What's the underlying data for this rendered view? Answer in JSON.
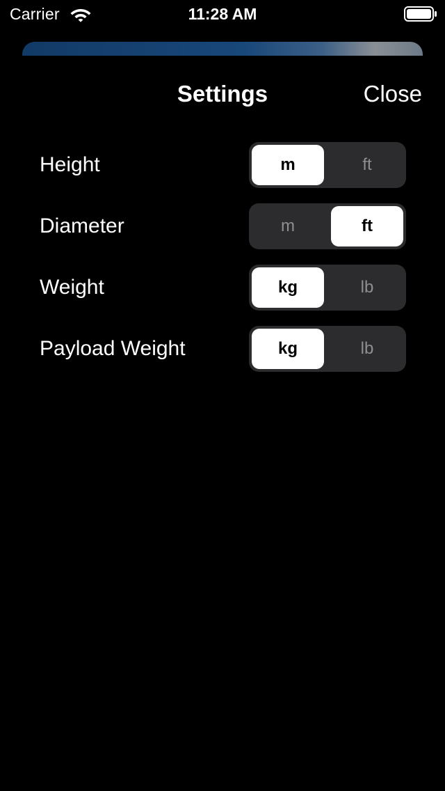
{
  "status_bar": {
    "carrier": "Carrier",
    "time": "11:28 AM",
    "icons": [
      "wifi-icon",
      "battery-icon"
    ]
  },
  "header": {
    "title": "Settings",
    "close_label": "Close"
  },
  "settings": [
    {
      "label": "Height",
      "options": [
        "m",
        "ft"
      ],
      "selected": 0
    },
    {
      "label": "Diameter",
      "options": [
        "m",
        "ft"
      ],
      "selected": 1
    },
    {
      "label": "Weight",
      "options": [
        "kg",
        "lb"
      ],
      "selected": 0
    },
    {
      "label": "Payload Weight",
      "options": [
        "kg",
        "lb"
      ],
      "selected": 0
    }
  ],
  "colors": {
    "background": "#000000",
    "segment_track": "#2c2c2e",
    "segment_selected": "#ffffff",
    "segment_unselected_text": "#8e8e93"
  }
}
